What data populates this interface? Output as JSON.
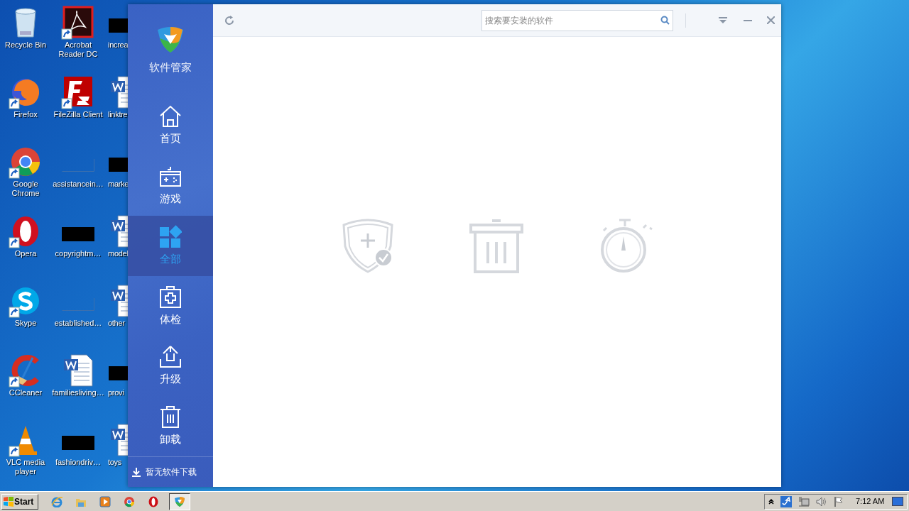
{
  "desktop": {
    "columns": [
      {
        "icons": [
          {
            "label": "Recycle Bin",
            "kind": "recycle",
            "shortcut": false
          },
          {
            "label": "Firefox",
            "kind": "firefox",
            "shortcut": true
          },
          {
            "label": "Google Chrome",
            "kind": "chrome",
            "shortcut": true
          },
          {
            "label": "Opera",
            "kind": "opera",
            "shortcut": true
          },
          {
            "label": "Skype",
            "kind": "skype",
            "shortcut": true
          },
          {
            "label": "CCleaner",
            "kind": "ccleaner",
            "shortcut": true
          },
          {
            "label": "VLC media player",
            "kind": "vlc",
            "shortcut": true
          }
        ]
      },
      {
        "icons": [
          {
            "label": "Acrobat Reader DC",
            "kind": "acrobat",
            "shortcut": true
          },
          {
            "label": "FileZilla Client",
            "kind": "filezilla",
            "shortcut": true
          },
          {
            "label": "assistancein…",
            "kind": "blank",
            "shortcut": false
          },
          {
            "label": "copyrightm…",
            "kind": "redacted",
            "shortcut": false
          },
          {
            "label": "established…",
            "kind": "blank",
            "shortcut": false
          },
          {
            "label": "familiesliving…",
            "kind": "word",
            "shortcut": false
          },
          {
            "label": "fashiondriv…",
            "kind": "redacted",
            "shortcut": false
          }
        ]
      },
      {
        "icons": [
          {
            "label": "increa",
            "kind": "redacted",
            "shortcut": false
          },
          {
            "label": "linktre",
            "kind": "word",
            "shortcut": false
          },
          {
            "label": "marke",
            "kind": "redacted",
            "shortcut": false
          },
          {
            "label": "model",
            "kind": "word",
            "shortcut": false
          },
          {
            "label": "other",
            "kind": "word",
            "shortcut": false
          },
          {
            "label": "provi",
            "kind": "redacted",
            "shortcut": false
          },
          {
            "label": "toys",
            "kind": "word",
            "shortcut": false
          }
        ]
      }
    ]
  },
  "window": {
    "app_name": "软件管家",
    "search": {
      "placeholder": "搜索要安装的软件"
    },
    "nav": [
      {
        "label": "首页",
        "kind": "home",
        "selected": false
      },
      {
        "label": "游戏",
        "kind": "game",
        "selected": false
      },
      {
        "label": "全部",
        "kind": "all",
        "selected": true
      },
      {
        "label": "体检",
        "kind": "checkup",
        "selected": false
      },
      {
        "label": "升级",
        "kind": "upgrade",
        "selected": false
      },
      {
        "label": "卸载",
        "kind": "uninstall",
        "selected": false
      }
    ],
    "download_status": "暂无软件下载"
  },
  "taskbar": {
    "start": "Start",
    "apps": [
      {
        "kind": "ie",
        "selected": false
      },
      {
        "kind": "folder",
        "selected": false
      },
      {
        "kind": "media",
        "selected": false
      },
      {
        "kind": "chrome",
        "selected": false
      },
      {
        "kind": "opera",
        "selected": false
      },
      {
        "kind": "shield",
        "selected": true
      }
    ],
    "clock": "7:12 AM"
  }
}
